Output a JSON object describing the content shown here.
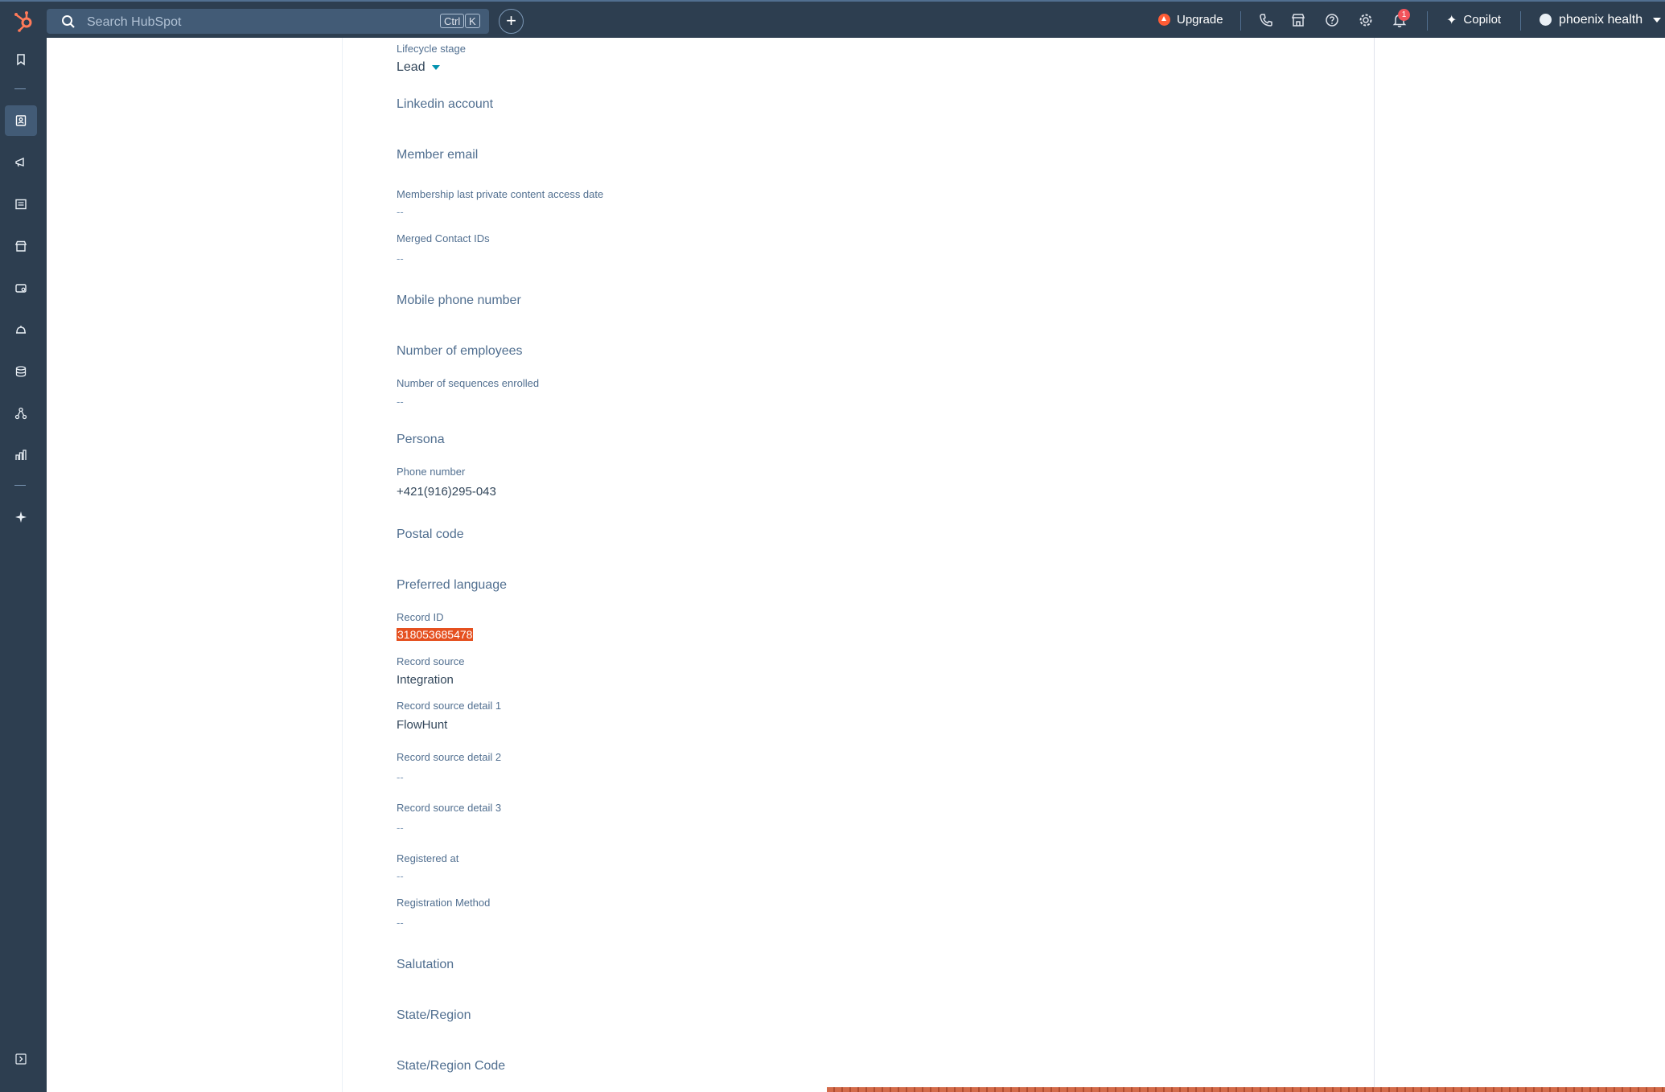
{
  "topbar": {
    "search_placeholder": "Search HubSpot",
    "shortcut_keys": [
      "Ctrl",
      "K"
    ],
    "upgrade_label": "Upgrade",
    "notification_count": "1",
    "copilot_label": "Copilot",
    "account_name": "phoenix health",
    "icons": [
      "hubspot-logo",
      "search-icon",
      "plus-icon",
      "phone-icon",
      "marketplace-icon",
      "help-icon",
      "settings-icon",
      "bell-icon",
      "sparkle-icon"
    ]
  },
  "sidebar": {
    "icons": [
      "bookmark-icon",
      "contacts-icon",
      "megaphone-icon",
      "content-icon",
      "commerce-icon",
      "sales-icon",
      "service-icon",
      "data-icon",
      "automation-icon",
      "reports-icon",
      "breeze-icon",
      "expand-icon"
    ],
    "active": "contacts-icon"
  },
  "colors": {
    "nav_bg": "#2d3e50",
    "accent": "#0091ae",
    "highlight": "#e5501f",
    "label": "#516f90"
  },
  "fields": {
    "lifecycle_stage": {
      "label": "Lifecycle stage",
      "value": "Lead"
    },
    "linkedin_account": {
      "label": "Linkedin account"
    },
    "member_email": {
      "label": "Member email"
    },
    "membership_access_date": {
      "label": "Membership last private content access date",
      "value": "--"
    },
    "merged_contact_ids": {
      "label": "Merged Contact IDs",
      "value": "--"
    },
    "mobile_phone": {
      "label": "Mobile phone number"
    },
    "number_of_employees": {
      "label": "Number of employees"
    },
    "sequences_enrolled": {
      "label": "Number of sequences enrolled",
      "value": "--"
    },
    "persona": {
      "label": "Persona"
    },
    "phone_number": {
      "label": "Phone number",
      "value": "+421(916)295-043"
    },
    "postal_code": {
      "label": "Postal code"
    },
    "preferred_language": {
      "label": "Preferred language"
    },
    "record_id": {
      "label": "Record ID",
      "value": "318053685478"
    },
    "record_source": {
      "label": "Record source",
      "value": "Integration"
    },
    "record_source_detail_1": {
      "label": "Record source detail 1",
      "value": "FlowHunt"
    },
    "record_source_detail_2": {
      "label": "Record source detail 2",
      "value": "--"
    },
    "record_source_detail_3": {
      "label": "Record source detail 3",
      "value": "--"
    },
    "registered_at": {
      "label": "Registered at",
      "value": "--"
    },
    "registration_method": {
      "label": "Registration Method",
      "value": "--"
    },
    "salutation": {
      "label": "Salutation"
    },
    "state_region": {
      "label": "State/Region"
    },
    "state_region_code": {
      "label": "State/Region Code"
    }
  }
}
